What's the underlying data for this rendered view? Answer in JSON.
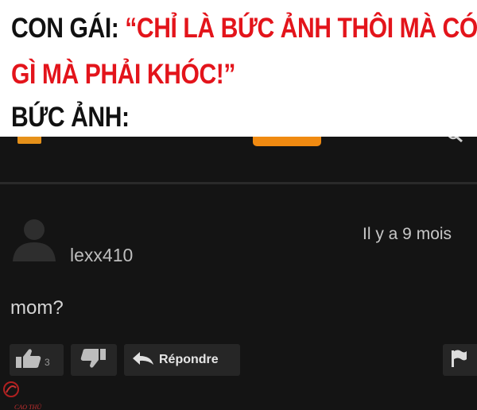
{
  "caption": {
    "line1_label": "CON GÁI:",
    "line1_quote": "“CHỈ LÀ BỨC ẢNH THÔI MÀ CÓ",
    "line2_quote": "GÌ MÀ PHẢI KHÓC!”",
    "line3_label": "BỨC ẢNH:",
    "label_color": "#111111",
    "quote_color": "#e3141b"
  },
  "screenshot": {
    "background": "#141414",
    "brand_accent": "#f08a11",
    "icons": [
      "menu-icon",
      "search-icon",
      "avatar-icon",
      "thumbs-up-icon",
      "thumbs-down-icon",
      "reply-arrow-icon",
      "flag-icon"
    ],
    "comment": {
      "username": "lexx410",
      "timestamp": "Il y a 9 mois",
      "text": "mom?",
      "like_count": "3",
      "reply_label": "Répondre"
    }
  },
  "watermark": {
    "text": "CAO THỦ"
  }
}
